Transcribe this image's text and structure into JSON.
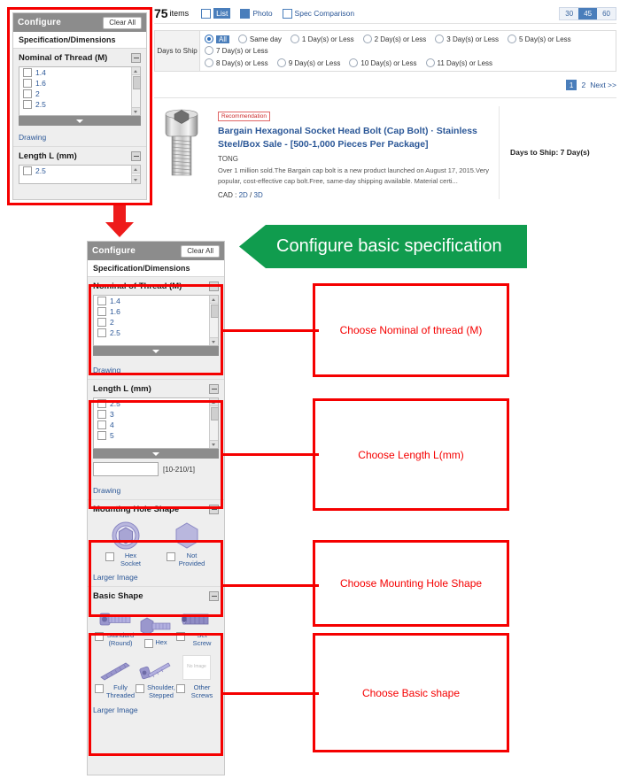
{
  "top_panel": {
    "header_title": "Configure",
    "clear_all": "Clear All",
    "subheader": "Specification/Dimensions",
    "section1_title": "Nominal of Thread (M)",
    "section1_options": [
      "1.4",
      "1.6",
      "2",
      "2.5"
    ],
    "drawing_link": "Drawing",
    "section2_title": "Length L (mm)",
    "section2_options": [
      "2.5"
    ]
  },
  "results": {
    "item_count": "75",
    "item_word": "items",
    "view_modes": [
      {
        "label": "List",
        "icon": "list-icon",
        "selected": true
      },
      {
        "label": "Photo",
        "icon": "grid-icon",
        "selected": false
      },
      {
        "label": "Spec Comparison",
        "icon": "columns-icon",
        "selected": false
      }
    ],
    "per_page": [
      {
        "label": "30",
        "selected": false
      },
      {
        "label": "45",
        "selected": true
      },
      {
        "label": "60",
        "selected": false
      }
    ],
    "ship_filter_label": "Days to Ship",
    "ship_options_row1": [
      {
        "label": "All",
        "selected": true
      },
      {
        "label": "Same day",
        "selected": false
      },
      {
        "label": "1 Day(s) or Less",
        "selected": false
      },
      {
        "label": "2 Day(s) or Less",
        "selected": false
      },
      {
        "label": "3 Day(s) or Less",
        "selected": false
      },
      {
        "label": "5 Day(s) or Less",
        "selected": false
      },
      {
        "label": "7 Day(s) or Less",
        "selected": false
      }
    ],
    "ship_options_row2": [
      {
        "label": "8 Day(s) or Less",
        "selected": false
      },
      {
        "label": "9 Day(s) or Less",
        "selected": false
      },
      {
        "label": "10 Day(s) or Less",
        "selected": false
      },
      {
        "label": "11 Day(s) or Less",
        "selected": false
      }
    ],
    "pagination": [
      {
        "label": "1",
        "selected": true
      },
      {
        "label": "2",
        "selected": false
      },
      {
        "label": "Next >>",
        "selected": false
      }
    ],
    "product": {
      "badge": "Recommendation",
      "title": "Bargain Hexagonal Socket Head Bolt (Cap Bolt) · Stainless Steel/Box Sale -  [500-1,000 Pieces Per Package]",
      "brand": "TONG",
      "description": "Over 1 million sold.The Bargain cap bolt is a new product launched on August 17, 2015.Very popular, cost-effective cap bolt.Free, same-day shipping available. Material certi...",
      "cad_label": "CAD :",
      "cad_2d": "2D",
      "cad_sep": "/",
      "cad_3d": "3D",
      "ship_info": "Days to Ship: 7 Day(s)"
    }
  },
  "banner": {
    "text": "Configure basic specification",
    "color": "#109c4e"
  },
  "detail_panel": {
    "header_title": "Configure",
    "clear_all": "Clear All",
    "subheader": "Specification/Dimensions",
    "nominal": {
      "title": "Nominal of Thread (M)",
      "options": [
        "1.4",
        "1.6",
        "2",
        "2.5"
      ],
      "drawing_link": "Drawing"
    },
    "length": {
      "title": "Length L (mm)",
      "options": [
        "2.5",
        "3",
        "4",
        "5"
      ],
      "range_hint": "[10-210/1]",
      "range_value": "",
      "drawing_link": "Drawing"
    },
    "mounting": {
      "title": "Mounting Hole Shape",
      "options": [
        {
          "label": "Hex Socket",
          "icon": "hex-socket-icon"
        },
        {
          "label": "Not Provided",
          "icon": "hex-solid-icon"
        }
      ],
      "larger_image_link": "Larger Image"
    },
    "basic_shape": {
      "title": "Basic Shape",
      "options": [
        {
          "label": "Standard (Round)",
          "icon": "round-head-bolt-icon"
        },
        {
          "label": "Hex",
          "icon": "hex-head-bolt-icon"
        },
        {
          "label": "Set Screw",
          "icon": "set-screw-icon"
        },
        {
          "label": "Fully Threaded",
          "icon": "fully-threaded-icon"
        },
        {
          "label": "Shoulder, Stepped",
          "icon": "shoulder-stepped-icon"
        },
        {
          "label": "Other Screws",
          "icon": "no-image-icon"
        }
      ],
      "no_image_text": "No Image",
      "larger_image_link": "Larger Image"
    }
  },
  "annotations": {
    "accent_color": "#f50000",
    "callouts": [
      {
        "text": "Choose Nominal of thread (M)"
      },
      {
        "text": "Choose Length L(mm)"
      },
      {
        "text": "Choose Mounting Hole Shape"
      },
      {
        "text": "Choose Basic shape"
      }
    ]
  }
}
